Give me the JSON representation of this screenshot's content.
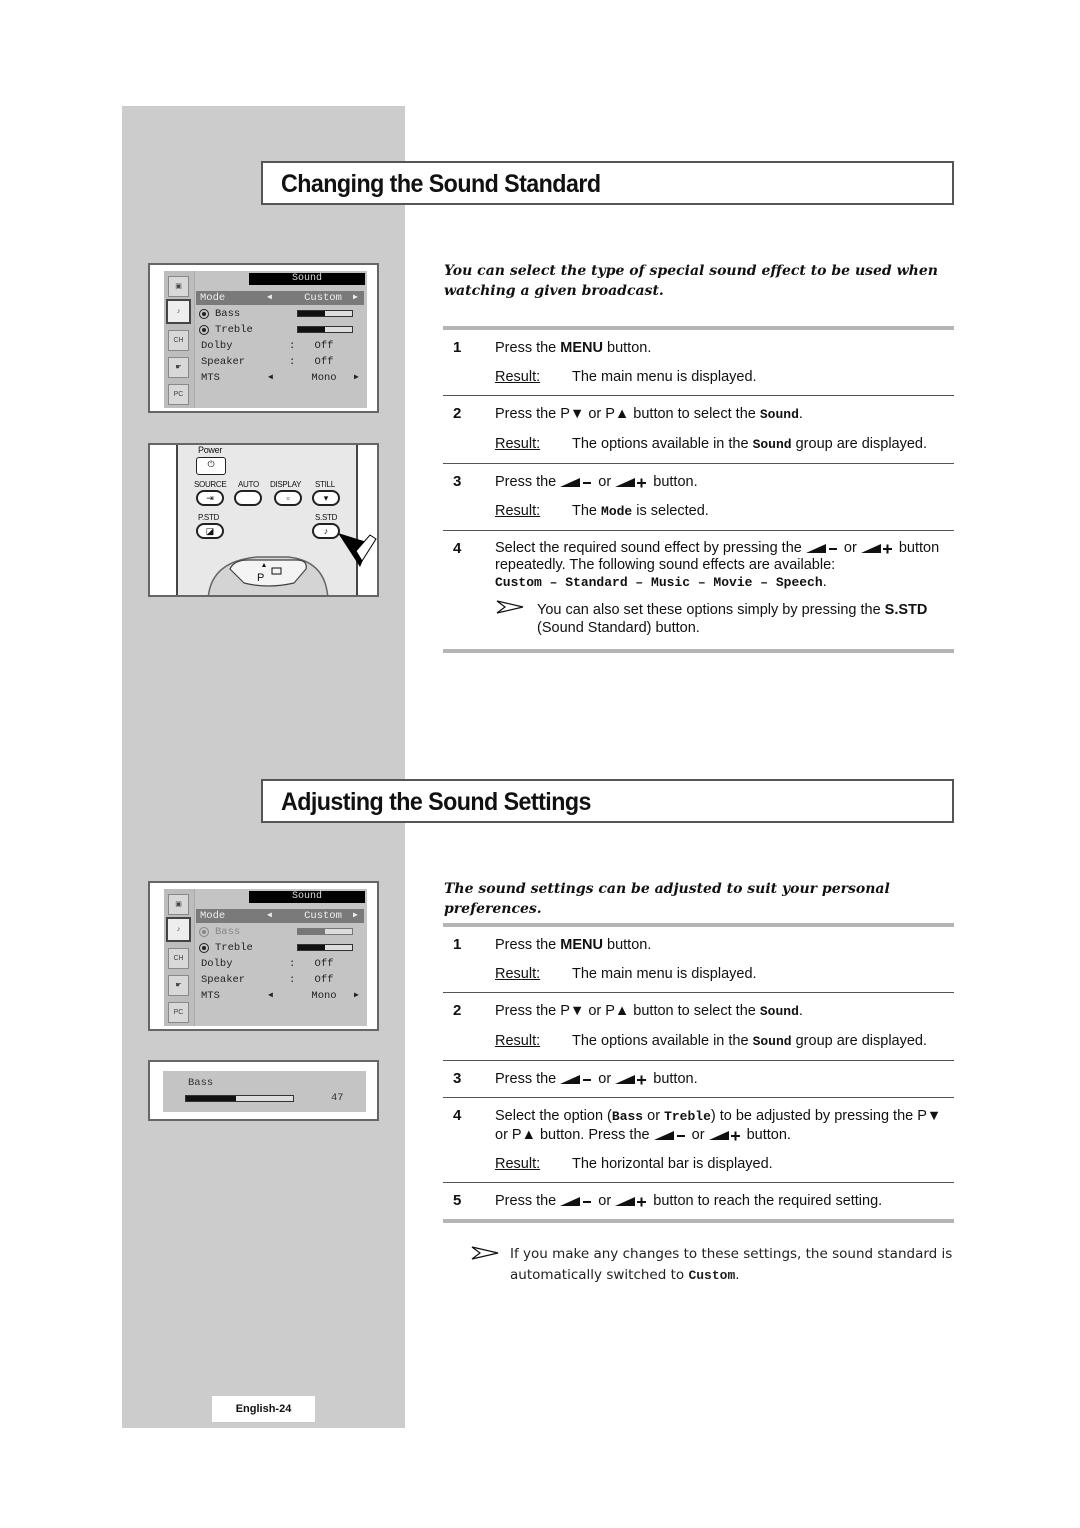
{
  "page": {
    "number_label": "English-24"
  },
  "icons": {
    "osd_side": [
      "tv-picture",
      "sound-note",
      "channel",
      "setup-hand",
      "pc"
    ]
  },
  "section1": {
    "title": "Changing the Sound Standard",
    "intro": "You can select the type of special sound effect to be used when watching a given broadcast.",
    "osd": {
      "title": "Sound",
      "rows": [
        {
          "label": "Mode",
          "value": "Custom",
          "type": "arrows",
          "highlight": true
        },
        {
          "label": "Bass",
          "type": "bar",
          "level": 0.5
        },
        {
          "label": "Treble",
          "type": "bar",
          "level": 0.5
        },
        {
          "label": "Dolby",
          "value": "Off",
          "type": "colon"
        },
        {
          "label": "Speaker",
          "value": "Off",
          "type": "colon"
        },
        {
          "label": "MTS",
          "value": "Mono",
          "type": "arrows"
        }
      ]
    },
    "remote": {
      "power": "Power",
      "source": "SOURCE",
      "auto": "AUTO",
      "display": "DISPLAY",
      "still": "STILL",
      "pstd": "P.STD",
      "sstd": "S.STD",
      "p": "P"
    },
    "steps": [
      {
        "num": "1",
        "pre": "Press the ",
        "bold": "MENU",
        "post": " button.",
        "result_label": "Result:",
        "result": "The main menu is displayed."
      },
      {
        "num": "2",
        "pre": "Press the P▼ or P▲ button to select the ",
        "mono": "Sound",
        "post": ".",
        "result_label": "Result:",
        "result_pre": "The options available in the ",
        "result_mono": "Sound",
        "result_post": " group are displayed."
      },
      {
        "num": "3",
        "pre": "Press the ",
        "or": " or ",
        "post": " button.",
        "result_label": "Result:",
        "result_pre": "The ",
        "result_mono": "Mode",
        "result_post": " is selected."
      },
      {
        "num": "4",
        "pre": "Select the required sound effect by pressing the ",
        "or": " or ",
        "post": " button repeatedly. The following sound effects are available:",
        "effects": "Custom – Standard – Music – Movie – Speech",
        "effects_end": ".",
        "note_pre": "You can also set these options simply by pressing the ",
        "note_bold": "S.STD",
        "note_post": " (Sound Standard) button."
      }
    ]
  },
  "section2": {
    "title": "Adjusting the Sound Settings",
    "intro": "The sound settings can be adjusted to suit your personal preferences.",
    "osd": {
      "title": "Sound",
      "rows": [
        {
          "label": "Mode",
          "value": "Custom",
          "highlight": true
        },
        {
          "label": "Bass",
          "level": 0.5,
          "dimmed": true
        },
        {
          "label": "Treble",
          "level": 0.5
        },
        {
          "label": "Dolby",
          "value": "Off"
        },
        {
          "label": "Speaker",
          "value": "Off"
        },
        {
          "label": "MTS",
          "value": "Mono"
        }
      ]
    },
    "bass_popup": {
      "label": "Bass",
      "value": "47",
      "level": 0.47
    },
    "steps": [
      {
        "num": "1",
        "pre": "Press the ",
        "bold": "MENU",
        "post": " button.",
        "result_label": "Result:",
        "result": "The main menu is displayed."
      },
      {
        "num": "2",
        "pre": "Press the P▼ or P▲ button to select the ",
        "mono": "Sound",
        "post": ".",
        "result_label": "Result:",
        "result_pre": "The options available in the ",
        "result_mono": "Sound",
        "result_post": " group are displayed."
      },
      {
        "num": "3",
        "pre": "Press the ",
        "or": " or ",
        "post": " button."
      },
      {
        "num": "4",
        "pre": "Select the option (",
        "mono1": "Bass",
        "mid": " or ",
        "mono2": "Treble",
        "post1": ") to be adjusted by pressing the P▼ or P▲ button. Press the ",
        "or": " or ",
        "post": " button.",
        "result_label": "Result:",
        "result": "The horizontal bar is displayed."
      },
      {
        "num": "5",
        "pre": "Press the ",
        "or": " or ",
        "post": " button to reach the required setting."
      }
    ],
    "final_note_pre": "If you make any changes to these settings, the sound standard is automatically switched to ",
    "final_note_mono": "Custom",
    "final_note_post": "."
  }
}
